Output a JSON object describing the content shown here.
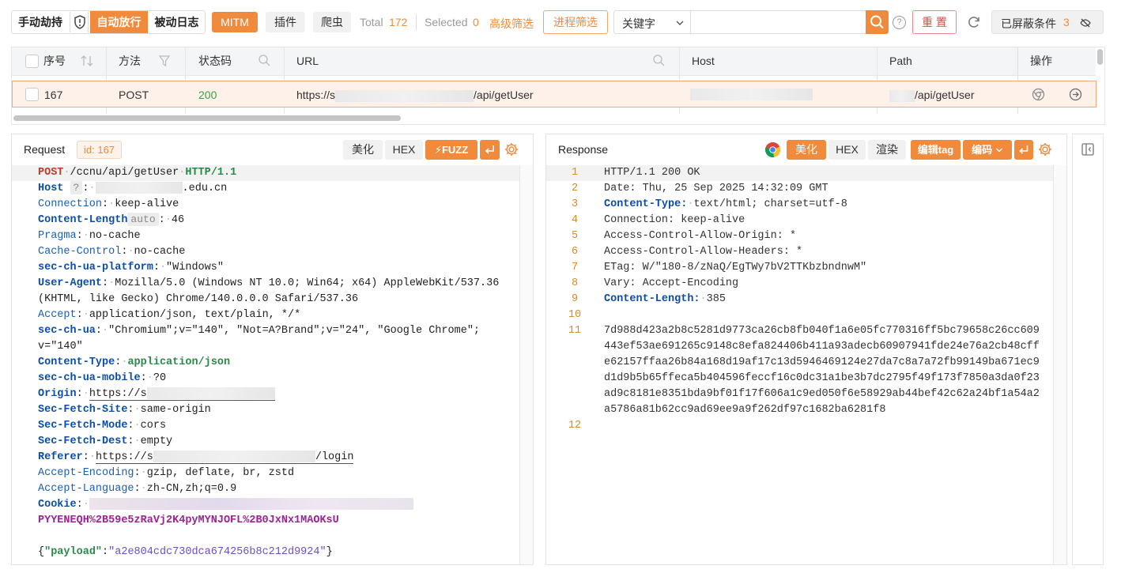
{
  "toolbar": {
    "tab_intercept": "手动劫持",
    "tab_auto": "自动放行",
    "tab_log": "被动日志",
    "mitm": "MITM",
    "plugins": "插件",
    "crawler": "爬虫",
    "total_label": "Total",
    "total_value": "172",
    "selected_label": "Selected",
    "selected_value": "0",
    "advanced_filter": "高级筛选",
    "process_filter": "进程筛选",
    "search_type": "关键字",
    "search_value": "",
    "reset": "重 置",
    "blocked_label": "已屏蔽条件",
    "blocked_count": "3"
  },
  "table": {
    "headers": {
      "seq": "序号",
      "method": "方法",
      "status": "状态码",
      "url": "URL",
      "host": "Host",
      "path": "Path",
      "action": "操作"
    },
    "row": {
      "seq": "167",
      "method": "POST",
      "status": "200",
      "url_prefix": "https://s",
      "url_suffix": "/api/getUser",
      "path_suffix": "/api/getUser"
    }
  },
  "request": {
    "title": "Request",
    "id_label": "id: 167",
    "beautify": "美化",
    "hex": "HEX",
    "fuzz": "FUZZ",
    "lines": {
      "l1_method": "POST",
      "l1_path": "/ccnu/api/getUser",
      "l1_proto": "HTTP/1.1",
      "host_k": "Host",
      "host_tag": "?",
      "host_v": ".edu.cn",
      "conn_k": "Connection",
      "conn_v": "keep-alive",
      "cl_k": "Content-Length",
      "cl_tag": "auto",
      "cl_v": "46",
      "pragma_k": "Pragma",
      "pragma_v": "no-cache",
      "cc_k": "Cache-Control",
      "cc_v": "no-cache",
      "plat_k": "sec-ch-ua-platform",
      "plat_v": "\"Windows\"",
      "ua_k": "User-Agent",
      "ua_v1": "Mozilla/5.0 (Windows NT 10.0; Win64; x64) AppleWebKit/537.36",
      "ua_v2": "(KHTML, like Gecko) Chrome/140.0.0.0 Safari/537.36",
      "acc_k": "Accept",
      "acc_v": "application/json, text/plain, */*",
      "ua2_k": "sec-ch-ua",
      "ua2_v1": "\"Chromium\";v=\"140\", \"Not=A?Brand\";v=\"24\", \"Google Chrome\";",
      "ua2_v2": "v=\"140\"",
      "ct_k": "Content-Type",
      "ct_v": "application/json",
      "mob_k": "sec-ch-ua-mobile",
      "mob_v": "?0",
      "origin_k": "Origin",
      "origin_v": "https://s",
      "sfs_k": "Sec-Fetch-Site",
      "sfs_v": "same-origin",
      "sfm_k": "Sec-Fetch-Mode",
      "sfm_v": "cors",
      "sfd_k": "Sec-Fetch-Dest",
      "sfd_v": "empty",
      "ref_k": "Referer",
      "ref_v1": "https://s",
      "ref_v2": "/login",
      "ae_k": "Accept-Encoding",
      "ae_v": "gzip, deflate, br, zstd",
      "al_k": "Accept-Language",
      "al_v": "zh-CN,zh;q=0.9",
      "cookie_k": "Cookie",
      "cookie_v2": "PYYENEQH%2B59e5zRaVj2K4pyMYNJOFL%2B0JxNx1MAOKsU",
      "body_key": "\"payload\"",
      "body_val": "\"a2e804cdc730dca674256b8c212d9924\""
    }
  },
  "response": {
    "title": "Response",
    "beautify": "美化",
    "hex": "HEX",
    "render": "渲染",
    "edit_tag": "编辑tag",
    "encoding": "编码",
    "lines": [
      {
        "n": "1",
        "t": "HTTP/1.1 200 OK",
        "kind": "plain"
      },
      {
        "n": "2",
        "t": "Date: Thu, 25 Sep 2025 14:32:09 GMT",
        "kind": "plain"
      },
      {
        "n": "3",
        "k": "Content-Type:",
        "v": "text/html; charset=utf-8",
        "kind": "kv"
      },
      {
        "n": "4",
        "t": "Connection: keep-alive",
        "kind": "plain"
      },
      {
        "n": "5",
        "t": "Access-Control-Allow-Origin: *",
        "kind": "plain"
      },
      {
        "n": "6",
        "t": "Access-Control-Allow-Headers: *",
        "kind": "plain"
      },
      {
        "n": "7",
        "t": "ETag: W/\"180-8/zNaQ/EgTWy7bV2TTKbzbndnwM\"",
        "kind": "plain"
      },
      {
        "n": "8",
        "t": "Vary: Accept-Encoding",
        "kind": "plain"
      },
      {
        "n": "9",
        "k": "Content-Length:",
        "v": "385",
        "kind": "kv"
      },
      {
        "n": "10",
        "t": "",
        "kind": "plain"
      },
      {
        "n": "11",
        "t": "7d988d423a2b8c5281d9773ca26cb8fb040f1a6e05fc770316ff5bc79658c26cc609",
        "kind": "plain"
      },
      {
        "n": "",
        "t": "443ef53ae691265c9148c8efa824406b411a93adecb60907941fde24e76a2cb48cff",
        "kind": "plain"
      },
      {
        "n": "",
        "t": "e62157ffaa26b84a168d19af17c13d5946469124e27da7c8a7a72fb99149ba671ec9",
        "kind": "plain"
      },
      {
        "n": "",
        "t": "d1d9b5b65ffeca5b404596feccf16c0dc31a1be3b7dc2795f49f173f7850a3da0f23",
        "kind": "plain"
      },
      {
        "n": "",
        "t": "ad9c8181e8351bda9bf01f17f606a1c9ed050f6e58929ab44bef42c62a24bf1a54a2",
        "kind": "plain"
      },
      {
        "n": "",
        "t": "a5786a81b62cc9ad69ee9a9f262df97c1682ba6281f8",
        "kind": "plain"
      },
      {
        "n": "12",
        "t": "",
        "kind": "plain"
      }
    ]
  }
}
